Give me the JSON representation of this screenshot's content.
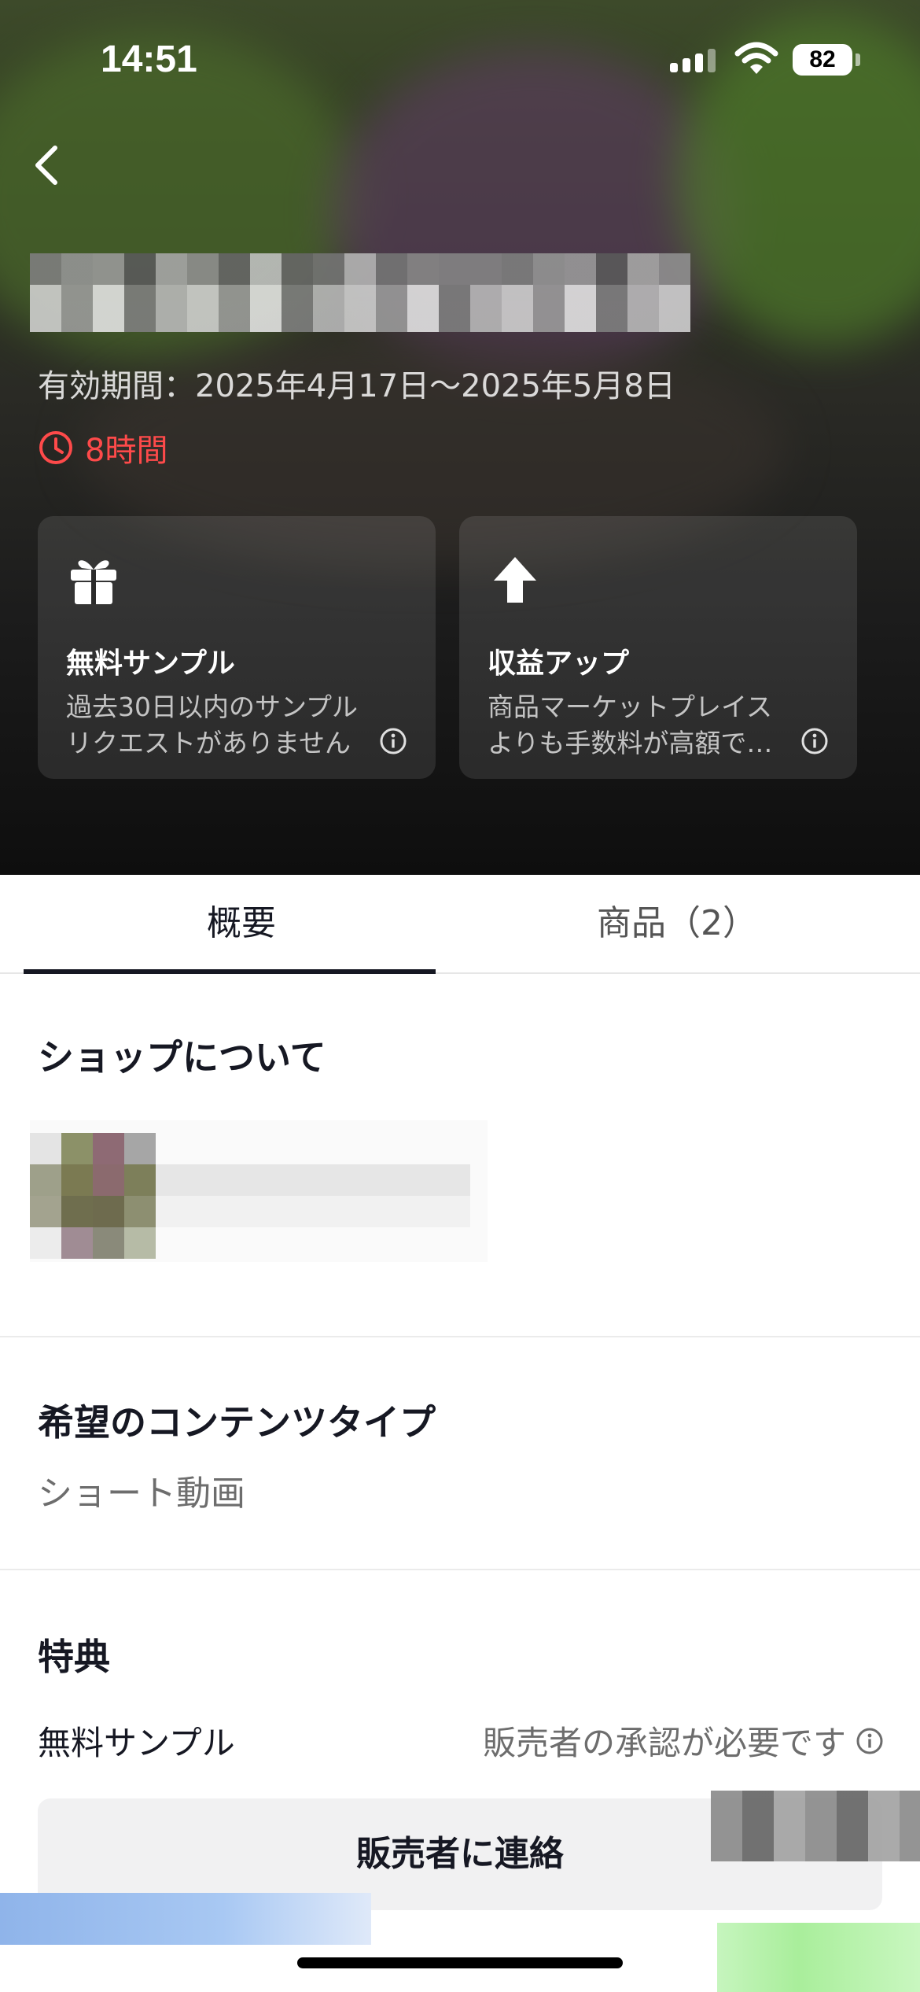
{
  "status_bar": {
    "time": "14:51",
    "battery": "82"
  },
  "hero": {
    "validity": "有効期間：2025年4月17日～2025年5月8日",
    "countdown": "8時間",
    "cards": [
      {
        "icon": "gift-icon",
        "title": "無料サンプル",
        "description": "過去30日以内のサンプルリクエストがありません"
      },
      {
        "icon": "arrow-up-icon",
        "title": "収益アップ",
        "description": "商品マーケットプレイスよりも手数料が高額で…"
      }
    ]
  },
  "tabs": [
    {
      "label": "概要",
      "active": true
    },
    {
      "label": "商品（2）",
      "active": false
    }
  ],
  "about": {
    "title": "ショップについて"
  },
  "content_type": {
    "title": "希望のコンテンツタイプ",
    "value": "ショート動画"
  },
  "benefits": {
    "title": "特典",
    "item_label": "無料サンプル",
    "item_value": "販売者の承認が必要です"
  },
  "contact_button": "販売者に連絡",
  "colors": {
    "accent_red": "#fe4a4a",
    "text_primary": "#161823",
    "button_bg": "#f1f1f2"
  }
}
